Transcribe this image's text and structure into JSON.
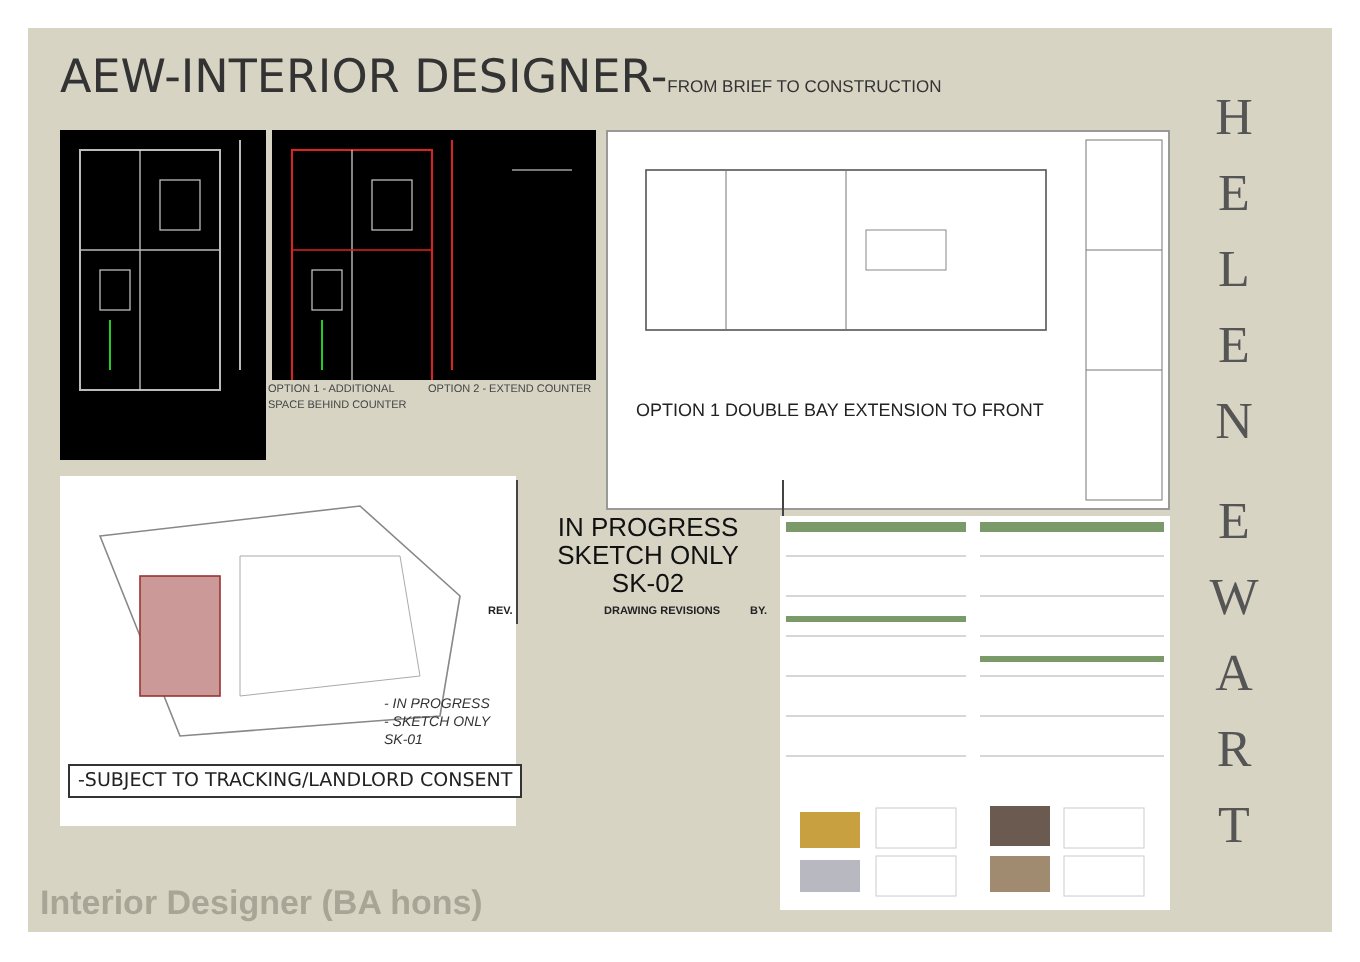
{
  "title": {
    "main": "AEW-INTERIOR DESIGNER-",
    "sub": "FROM BRIEF TO CONSTRUCTION"
  },
  "name_words": [
    "HELEN",
    "EWART"
  ],
  "cad_captions": [
    "OPTION 1 - ADDITIONAL SPACE BEHIND COUNTER",
    "OPTION 2 - EXTEND COUNTER"
  ],
  "floor_plan": {
    "heading": "OPTION 1 DOUBLE BAY EXTENSION TO FRONT"
  },
  "site_plan": {
    "note": "-SUBJECT TO TRACKING/LANDLORD CONSENT",
    "stamp": [
      "- IN PROGRESS",
      "- SKETCH ONLY",
      "SK-01"
    ]
  },
  "revisions": {
    "columns": [
      "REV.",
      "DRAWING REVISIONS",
      "BY."
    ]
  },
  "stamp": [
    "IN PROGRESS",
    "SKETCH ONLY",
    "SK-02"
  ],
  "footer": "Interior Designer (BA hons)"
}
